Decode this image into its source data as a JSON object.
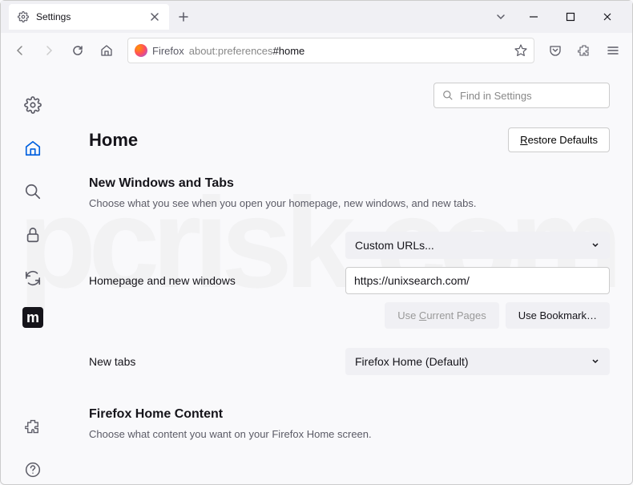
{
  "titlebar": {
    "tab_title": "Settings"
  },
  "navbar": {
    "identity": "Firefox",
    "url_prefix": "about:preferences",
    "url_hash": "#home"
  },
  "search": {
    "placeholder": "Find in Settings"
  },
  "header": {
    "title": "Home",
    "restore": "Restore Defaults"
  },
  "section1": {
    "heading": "New Windows and Tabs",
    "desc": "Choose what you see when you open your homepage, new windows, and new tabs.",
    "homepage_label": "Homepage and new windows",
    "homepage_select": "Custom URLs...",
    "homepage_url": "https://unixsearch.com/",
    "use_current": "Use Current Pages",
    "use_bookmark": "Use Bookmark…",
    "newtabs_label": "New tabs",
    "newtabs_select": "Firefox Home (Default)"
  },
  "section2": {
    "heading": "Firefox Home Content",
    "desc": "Choose what content you want on your Firefox Home screen."
  }
}
